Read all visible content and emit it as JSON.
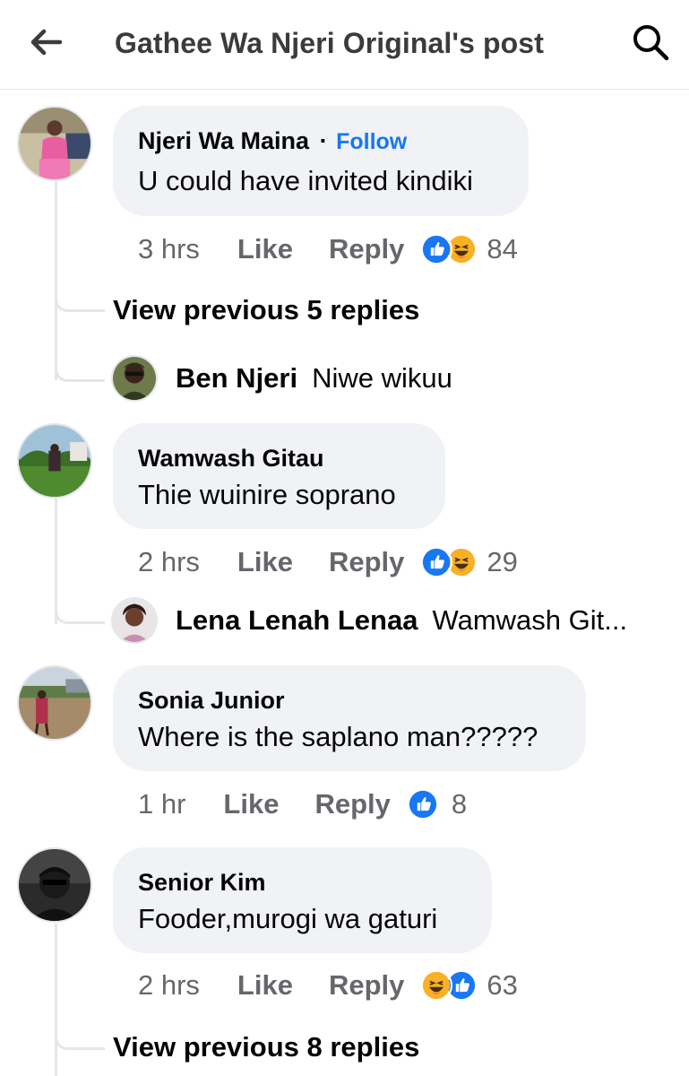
{
  "header": {
    "title": "Gathee Wa Njeri Original's post",
    "back_icon": "arrow-left-icon",
    "search_icon": "search-icon"
  },
  "colors": {
    "link": "#1877f2",
    "bubble_bg": "#f0f2f5",
    "meta_text": "#65676b",
    "like_blue": "#1877f2",
    "haha_yellow": "#f7b125"
  },
  "comments": [
    {
      "author": "Njeri Wa Maina",
      "separator": "·",
      "follow_label": "Follow",
      "text": "U could have invited kindiki",
      "time": "3 hrs",
      "like_label": "Like",
      "reply_label": "Reply",
      "reaction_icons": [
        "like-reaction-icon",
        "haha-reaction-icon"
      ],
      "reaction_count": "84",
      "view_replies_label": "View previous 5 replies",
      "reply_preview": {
        "name": "Ben Njeri",
        "text": "Niwe wikuu"
      }
    },
    {
      "author": "Wamwash Gitau",
      "text": "Thie wuinire soprano",
      "time": "2 hrs",
      "like_label": "Like",
      "reply_label": "Reply",
      "reaction_icons": [
        "like-reaction-icon",
        "haha-reaction-icon"
      ],
      "reaction_count": "29",
      "reply_preview": {
        "name": "Lena Lenah Lenaa",
        "text": "Wamwash Git..."
      }
    },
    {
      "author": "Sonia Junior",
      "text": "Where is the saplano man?????",
      "time": "1 hr",
      "like_label": "Like",
      "reply_label": "Reply",
      "reaction_icons": [
        "like-reaction-icon"
      ],
      "reaction_count": "8"
    },
    {
      "author": "Senior Kim",
      "text": "Fooder,murogi wa gaturi",
      "time": "2 hrs",
      "like_label": "Like",
      "reply_label": "Reply",
      "reaction_icons": [
        "haha-reaction-icon",
        "like-reaction-icon"
      ],
      "reaction_count": "63",
      "view_replies_label": "View previous 8 replies"
    }
  ]
}
